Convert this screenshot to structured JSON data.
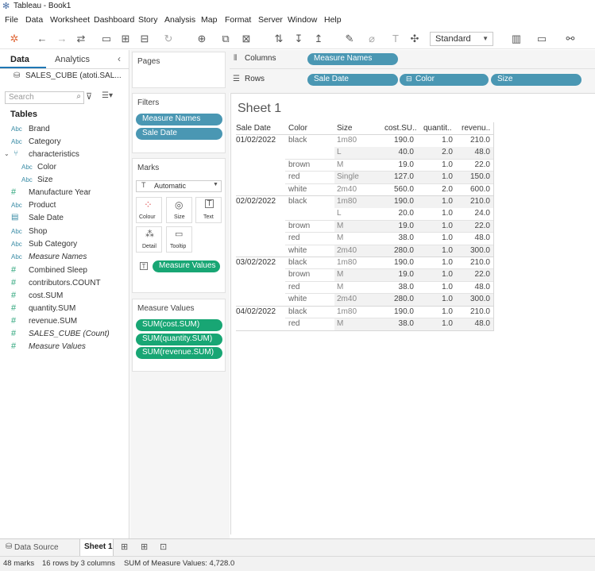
{
  "window": {
    "title": "Tableau - Book1"
  },
  "menu": [
    "File",
    "Data",
    "Worksheet",
    "Dashboard",
    "Story",
    "Analysis",
    "Map",
    "Format",
    "Server",
    "Window",
    "Help"
  ],
  "toolbar": {
    "fit_mode": "Standard"
  },
  "data_pane": {
    "tab_data": "Data",
    "tab_analytics": "Analytics",
    "datasource": "SALES_CUBE (atoti.SAL...",
    "search_placeholder": "Search",
    "tables_heading": "Tables",
    "fields": [
      {
        "icon": "Abc",
        "name": "Brand"
      },
      {
        "icon": "Abc",
        "name": "Category"
      },
      {
        "icon": "hierarchy",
        "name": "characteristics"
      },
      {
        "icon": "Abc",
        "name": "Color"
      },
      {
        "icon": "Abc",
        "name": "Size"
      },
      {
        "icon": "#",
        "name": "Manufacture Year"
      },
      {
        "icon": "Abc",
        "name": "Product"
      },
      {
        "icon": "date",
        "name": "Sale Date"
      },
      {
        "icon": "Abc",
        "name": "Shop"
      },
      {
        "icon": "Abc",
        "name": "Sub Category"
      },
      {
        "icon": "Abc",
        "name": "Measure Names"
      },
      {
        "icon": "#",
        "name": "Combined Sleep"
      },
      {
        "icon": "#",
        "name": "contributors.COUNT"
      },
      {
        "icon": "#",
        "name": "cost.SUM"
      },
      {
        "icon": "#",
        "name": "quantity.SUM"
      },
      {
        "icon": "#",
        "name": "revenue.SUM"
      },
      {
        "icon": "#",
        "name": "SALES_CUBE (Count)"
      },
      {
        "icon": "#",
        "name": "Measure Values"
      }
    ]
  },
  "shelves": {
    "pages": "Pages",
    "filters": "Filters",
    "filter_pills": [
      "Measure Names",
      "Sale Date"
    ],
    "marks": "Marks",
    "mark_type": "Automatic",
    "mark_cards": [
      "Colour",
      "Size",
      "Text",
      "Detail",
      "Tooltip"
    ],
    "marks_pill": "Measure Values",
    "measure_values_title": "Measure Values",
    "measure_values_pills": [
      "SUM(cost.SUM)",
      "SUM(quantity.SUM)",
      "SUM(revenue.SUM)"
    ],
    "columns_label": "Columns",
    "columns_pills": [
      "Measure Names"
    ],
    "rows_label": "Rows",
    "rows_pills": [
      "Sale Date",
      "Color",
      "Size"
    ]
  },
  "sheet": {
    "title": "Sheet 1",
    "headers": [
      "Sale Date",
      "Color",
      "Size",
      "cost.SU..",
      "quantit..",
      "revenu.."
    ],
    "rows": [
      {
        "date": "01/02/2022",
        "color": "black",
        "size": "1m80",
        "cost": "190.0",
        "qty": "1.0",
        "rev": "210.0"
      },
      {
        "date": "",
        "color": "",
        "size": "L",
        "cost": "40.0",
        "qty": "2.0",
        "rev": "48.0"
      },
      {
        "date": "",
        "color": "brown",
        "size": "M",
        "cost": "19.0",
        "qty": "1.0",
        "rev": "22.0"
      },
      {
        "date": "",
        "color": "red",
        "size": "Single",
        "cost": "127.0",
        "qty": "1.0",
        "rev": "150.0"
      },
      {
        "date": "",
        "color": "white",
        "size": "2m40",
        "cost": "560.0",
        "qty": "2.0",
        "rev": "600.0"
      },
      {
        "date": "02/02/2022",
        "color": "black",
        "size": "1m80",
        "cost": "190.0",
        "qty": "1.0",
        "rev": "210.0"
      },
      {
        "date": "",
        "color": "",
        "size": "L",
        "cost": "20.0",
        "qty": "1.0",
        "rev": "24.0"
      },
      {
        "date": "",
        "color": "brown",
        "size": "M",
        "cost": "19.0",
        "qty": "1.0",
        "rev": "22.0"
      },
      {
        "date": "",
        "color": "red",
        "size": "M",
        "cost": "38.0",
        "qty": "1.0",
        "rev": "48.0"
      },
      {
        "date": "",
        "color": "white",
        "size": "2m40",
        "cost": "280.0",
        "qty": "1.0",
        "rev": "300.0"
      },
      {
        "date": "03/02/2022",
        "color": "black",
        "size": "1m80",
        "cost": "190.0",
        "qty": "1.0",
        "rev": "210.0"
      },
      {
        "date": "",
        "color": "brown",
        "size": "M",
        "cost": "19.0",
        "qty": "1.0",
        "rev": "22.0"
      },
      {
        "date": "",
        "color": "red",
        "size": "M",
        "cost": "38.0",
        "qty": "1.0",
        "rev": "48.0"
      },
      {
        "date": "",
        "color": "white",
        "size": "2m40",
        "cost": "280.0",
        "qty": "1.0",
        "rev": "300.0"
      },
      {
        "date": "04/02/2022",
        "color": "black",
        "size": "1m80",
        "cost": "190.0",
        "qty": "1.0",
        "rev": "210.0"
      },
      {
        "date": "",
        "color": "red",
        "size": "M",
        "cost": "38.0",
        "qty": "1.0",
        "rev": "48.0"
      }
    ]
  },
  "tabs": {
    "data_source": "Data Source",
    "sheet1": "Sheet 1"
  },
  "status": {
    "marks": "48 marks",
    "rows_cols": "16 rows by 3 columns",
    "sum": "SUM of Measure Values: 4,728.0"
  }
}
